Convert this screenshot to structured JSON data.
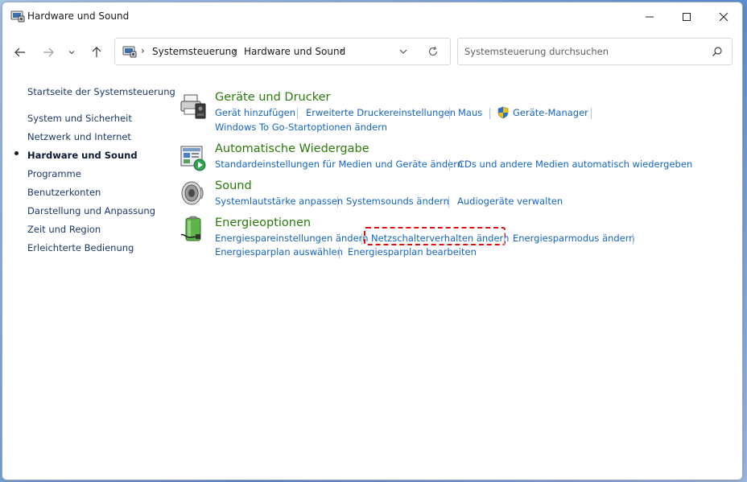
{
  "window": {
    "title": "Hardware und Sound",
    "icon": "control-panel-icon",
    "controls": [
      "minimize-icon",
      "maximize-icon",
      "close-icon"
    ]
  },
  "address": {
    "icon": "control-panel-icon",
    "crumbs": [
      "Systemsteuerung",
      "Hardware und Sound"
    ],
    "separator": "›"
  },
  "search": {
    "placeholder": "Systemsteuerung durchsuchen"
  },
  "sidebar": {
    "home": "Startseite der Systemsteuerung",
    "items": [
      {
        "label": "System und Sicherheit",
        "active": false
      },
      {
        "label": "Netzwerk und Internet",
        "active": false
      },
      {
        "label": "Hardware und Sound",
        "active": true
      },
      {
        "label": "Programme",
        "active": false
      },
      {
        "label": "Benutzerkonten",
        "active": false
      },
      {
        "label": "Darstellung und Anpassung",
        "active": false
      },
      {
        "label": "Zeit und Region",
        "active": false
      },
      {
        "label": "Erleichterte Bedienung",
        "active": false
      }
    ]
  },
  "categories": [
    {
      "title": "Geräte und Drucker",
      "icon": "printer-icon",
      "links": [
        "Gerät hinzufügen",
        "Erweiterte Druckereinstellungen",
        "Maus",
        "Geräte-Manager",
        "Windows To Go-Startoptionen ändern"
      ]
    },
    {
      "title": "Automatische Wiedergabe",
      "icon": "autoplay-icon",
      "links": [
        "Standardeinstellungen für Medien und Geräte ändern",
        "CDs und andere Medien automatisch wiedergeben"
      ]
    },
    {
      "title": "Sound",
      "icon": "speaker-icon",
      "links": [
        "Systemlautstärke anpassen",
        "Systemsounds ändern",
        "Audiogeräte verwalten"
      ]
    },
    {
      "title": "Energieoptionen",
      "icon": "battery-icon",
      "links": [
        "Energiespareinstellungen ändern",
        "Netzschalterverhalten ändern",
        "Energiesparmodus ändern",
        "Energiesparplan auswählen",
        "Energiesparplan bearbeiten"
      ]
    }
  ],
  "colors": {
    "category_title": "#2b7a0b",
    "link": "#1565c0",
    "highlight": "#e01010"
  }
}
